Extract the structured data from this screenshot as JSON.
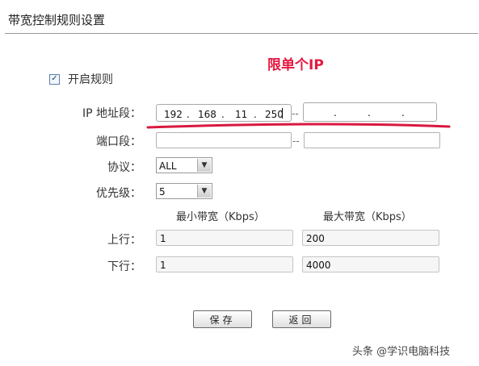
{
  "page_title": "带宽控制规则设置",
  "annotation": "限单个IP",
  "enable_rule": {
    "label": "开启规则",
    "checked": true,
    "check_glyph": "✓"
  },
  "ip_range": {
    "label": "IP 地址段：",
    "start": [
      "192",
      "168",
      "11",
      "250"
    ],
    "end": [
      "",
      "",
      "",
      ""
    ],
    "separator": "--",
    "dot": "."
  },
  "port_range": {
    "label": "端口段：",
    "start": "",
    "end": "",
    "separator": "--"
  },
  "protocol": {
    "label": "协议：",
    "value": "ALL"
  },
  "priority": {
    "label": "优先级：",
    "value": "5"
  },
  "bandwidth_headers": {
    "min": "最小带宽（Kbps）",
    "max": "最大带宽（Kbps）"
  },
  "upload": {
    "label": "上行：",
    "min": "1",
    "max": "200"
  },
  "download": {
    "label": "下行：",
    "min": "1",
    "max": "4000"
  },
  "buttons": {
    "save": "保存",
    "back": "返回"
  },
  "watermark": "头条 @学识电脑科技",
  "colors": {
    "annotation": "#e5173f",
    "underline": "#d9183f"
  }
}
